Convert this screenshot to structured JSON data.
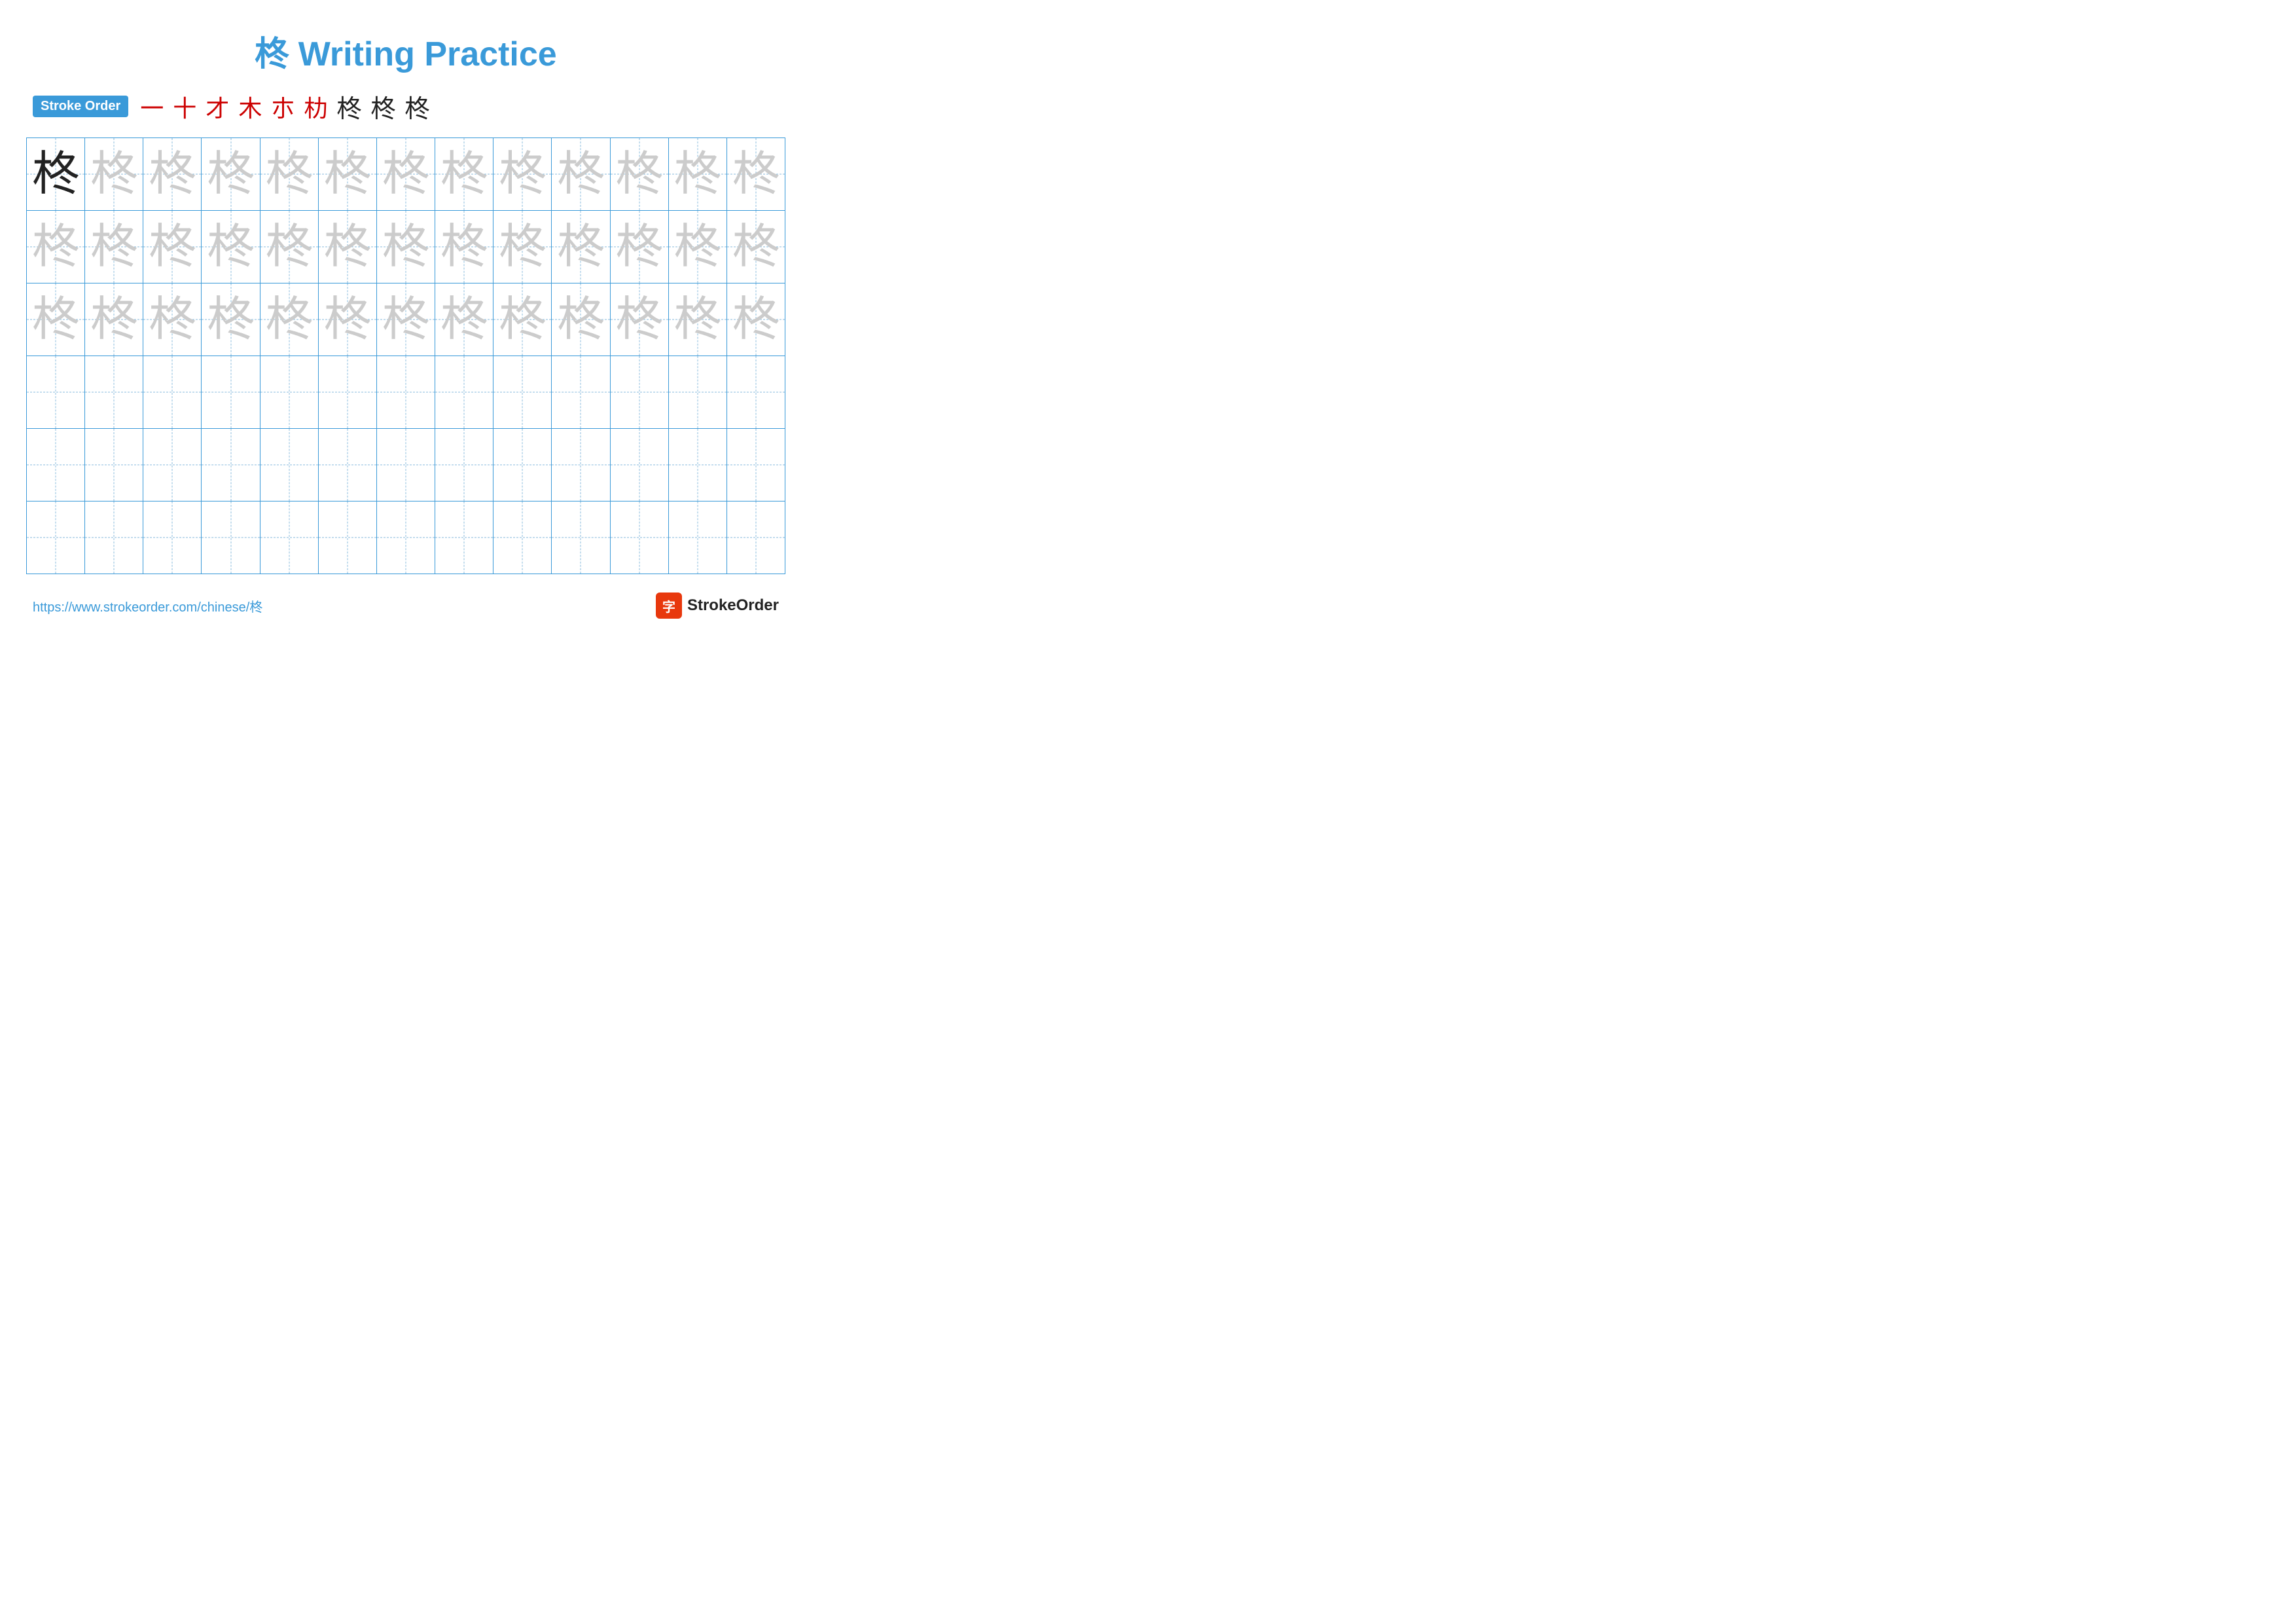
{
  "title": {
    "char": "柊",
    "text": " Writing Practice"
  },
  "stroke_order": {
    "badge_label": "Stroke Order",
    "strokes": [
      "一",
      "十",
      "才",
      "木",
      "朩",
      "朸",
      "柊",
      "柊",
      "柊"
    ]
  },
  "grid": {
    "rows": 6,
    "cols": 13,
    "char": "柊",
    "filled_rows": [
      {
        "row": 0,
        "cells": [
          {
            "type": "solid"
          },
          {
            "type": "faint"
          },
          {
            "type": "faint"
          },
          {
            "type": "faint"
          },
          {
            "type": "faint"
          },
          {
            "type": "faint"
          },
          {
            "type": "faint"
          },
          {
            "type": "faint"
          },
          {
            "type": "faint"
          },
          {
            "type": "faint"
          },
          {
            "type": "faint"
          },
          {
            "type": "faint"
          },
          {
            "type": "faint"
          }
        ]
      },
      {
        "row": 1,
        "cells": [
          {
            "type": "faint"
          },
          {
            "type": "faint"
          },
          {
            "type": "faint"
          },
          {
            "type": "faint"
          },
          {
            "type": "faint"
          },
          {
            "type": "faint"
          },
          {
            "type": "faint"
          },
          {
            "type": "faint"
          },
          {
            "type": "faint"
          },
          {
            "type": "faint"
          },
          {
            "type": "faint"
          },
          {
            "type": "faint"
          },
          {
            "type": "faint"
          }
        ]
      },
      {
        "row": 2,
        "cells": [
          {
            "type": "faint"
          },
          {
            "type": "faint"
          },
          {
            "type": "faint"
          },
          {
            "type": "faint"
          },
          {
            "type": "faint"
          },
          {
            "type": "faint"
          },
          {
            "type": "faint"
          },
          {
            "type": "faint"
          },
          {
            "type": "faint"
          },
          {
            "type": "faint"
          },
          {
            "type": "faint"
          },
          {
            "type": "faint"
          },
          {
            "type": "faint"
          }
        ]
      },
      {
        "row": 3,
        "cells": [
          {
            "type": "empty"
          },
          {
            "type": "empty"
          },
          {
            "type": "empty"
          },
          {
            "type": "empty"
          },
          {
            "type": "empty"
          },
          {
            "type": "empty"
          },
          {
            "type": "empty"
          },
          {
            "type": "empty"
          },
          {
            "type": "empty"
          },
          {
            "type": "empty"
          },
          {
            "type": "empty"
          },
          {
            "type": "empty"
          },
          {
            "type": "empty"
          }
        ]
      },
      {
        "row": 4,
        "cells": [
          {
            "type": "empty"
          },
          {
            "type": "empty"
          },
          {
            "type": "empty"
          },
          {
            "type": "empty"
          },
          {
            "type": "empty"
          },
          {
            "type": "empty"
          },
          {
            "type": "empty"
          },
          {
            "type": "empty"
          },
          {
            "type": "empty"
          },
          {
            "type": "empty"
          },
          {
            "type": "empty"
          },
          {
            "type": "empty"
          },
          {
            "type": "empty"
          }
        ]
      },
      {
        "row": 5,
        "cells": [
          {
            "type": "empty"
          },
          {
            "type": "empty"
          },
          {
            "type": "empty"
          },
          {
            "type": "empty"
          },
          {
            "type": "empty"
          },
          {
            "type": "empty"
          },
          {
            "type": "empty"
          },
          {
            "type": "empty"
          },
          {
            "type": "empty"
          },
          {
            "type": "empty"
          },
          {
            "type": "empty"
          },
          {
            "type": "empty"
          },
          {
            "type": "empty"
          }
        ]
      }
    ]
  },
  "footer": {
    "url": "https://www.strokeorder.com/chinese/柊",
    "logo_char": "字",
    "logo_text": "StrokeOrder"
  }
}
